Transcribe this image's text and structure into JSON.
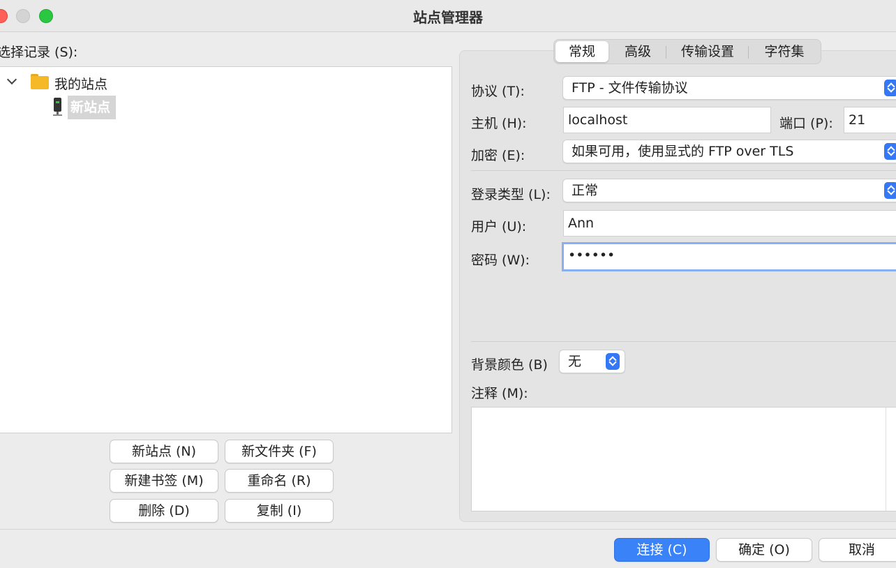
{
  "window": {
    "title": "站点管理器"
  },
  "left": {
    "select_label": "选择记录 (S):",
    "tree": {
      "folder_label": "我的站点",
      "site_label": "新站点"
    },
    "buttons": {
      "new_site": "新站点 (N)",
      "new_folder": "新文件夹 (F)",
      "new_bookmark": "新建书签 (M)",
      "rename": "重命名 (R)",
      "delete": "删除 (D)",
      "copy": "复制 (I)"
    }
  },
  "tabs": [
    "常规",
    "高级",
    "传输设置",
    "字符集"
  ],
  "form": {
    "protocol_label": "协议 (T):",
    "protocol_value": "FTP - 文件传输协议",
    "host_label": "主机 (H):",
    "host_value": "localhost",
    "port_label": "端口 (P):",
    "port_value": "21",
    "encryption_label": "加密 (E):",
    "encryption_value": "如果可用，使用显式的 FTP over TLS",
    "logon_type_label": "登录类型 (L):",
    "logon_type_value": "正常",
    "user_label": "用户 (U):",
    "user_value": "Ann",
    "password_label": "密码 (W):",
    "password_value": "••••••",
    "bg_color_label": "背景颜色 (B)",
    "bg_color_value": "无",
    "comments_label": "注释 (M):"
  },
  "footer": {
    "connect": "连接 (C)",
    "ok": "确定 (O)",
    "cancel": "取消"
  },
  "colors": {
    "accent": "#3478f6",
    "folder": "#f5b927"
  }
}
